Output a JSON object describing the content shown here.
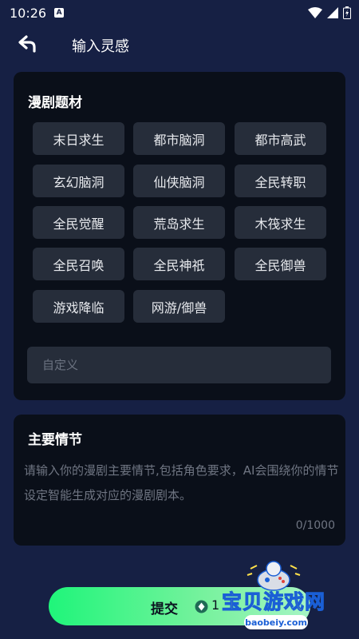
{
  "status": {
    "time": "10:26",
    "a_icon": "A"
  },
  "header": {
    "title": "输入灵感"
  },
  "genre": {
    "heading": "漫剧题材",
    "tags": [
      "末日求生",
      "都市脑洞",
      "都市高武",
      "玄幻脑洞",
      "仙侠脑洞",
      "全民转职",
      "全民觉醒",
      "荒岛求生",
      "木筏求生",
      "全民召唤",
      "全民神祇",
      "全民御兽",
      "游戏降临",
      "网游/御兽"
    ],
    "custom_placeholder": "自定义"
  },
  "plot": {
    "heading": "主要情节",
    "placeholder": "请输入你的漫剧主要情节,包括角色要求，AI会围绕你的情节设定智能生成对应的漫剧剧本。",
    "counter": "0/1000"
  },
  "submit": {
    "label": "提交",
    "cost": "1"
  },
  "watermark": {
    "text": "宝贝游戏网",
    "url": "baobeiy.com"
  },
  "colors": {
    "background": "#162044",
    "card": "#0a0f19",
    "tag": "#262d3a",
    "accent": "#1ff57a"
  }
}
